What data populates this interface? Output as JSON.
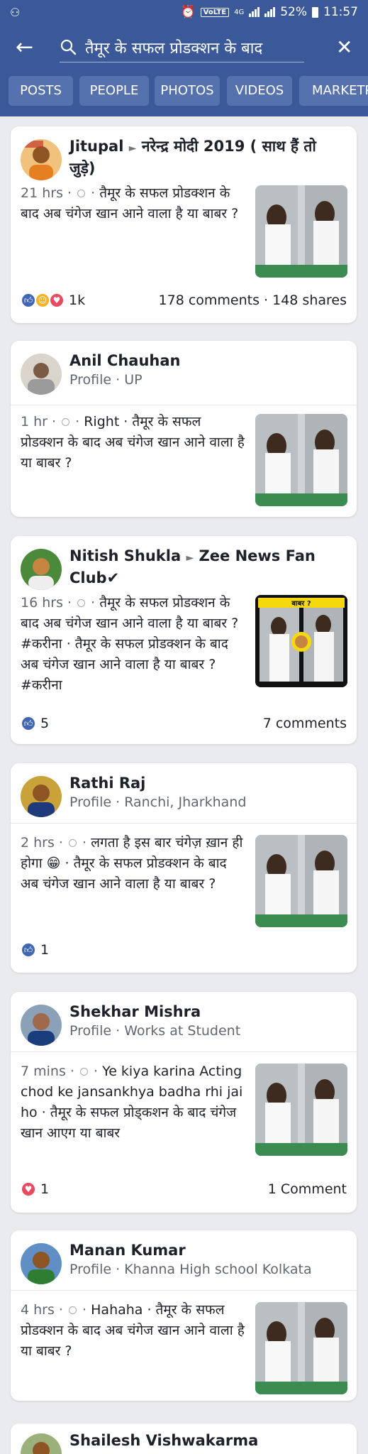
{
  "status_bar": {
    "left_icon": "incognito-icon",
    "volte": "VoLTE",
    "network": "4G",
    "battery": "52%",
    "time": "11:57"
  },
  "search": {
    "query": "तैमूर के सफल प्रोडक्शन के बाद"
  },
  "tabs": [
    "POSTS",
    "PEOPLE",
    "PHOTOS",
    "VIDEOS",
    "MARKETPLACE"
  ],
  "posts": [
    {
      "name": "Jitupal",
      "target": "नरेन्द्र मोदी 2019 ( साथ हैं तो जुड़े)",
      "subtitle": "",
      "time": "21 hrs",
      "text": "तैमूर के सफल प्रोडक्शन के बाद अब चंगेज खान आने वाला है या बाबर ?",
      "reactions": [
        "like",
        "haha",
        "love"
      ],
      "reaction_count": "1k",
      "comments": "178 comments",
      "shares": "148 shares",
      "thumb_caption": ""
    },
    {
      "name": "Anil Chauhan",
      "target": "",
      "subtitle": "Profile · UP",
      "time": "1 hr",
      "text": "Right · तैमूर के सफल प्रोडक्शन के बाद अब चंगेज खान आने वाला है या बाबर ?",
      "reactions": [],
      "reaction_count": "",
      "comments": "",
      "shares": "",
      "thumb_caption": ""
    },
    {
      "name": "Nitish Shukla",
      "target": "Zee News Fan Club✔",
      "subtitle": "",
      "time": "16 hrs",
      "text": "तैमूर के सफल प्रोडक्शन के बाद अब चंगेज खान आने वाला है या बाबर ? #करीना · तैमूर के सफल प्रोडक्शन के बाद अब चंगेज खान आने वाला है या बाबर ? #करीना",
      "reactions": [
        "like"
      ],
      "reaction_count": "5",
      "comments": "7 comments",
      "shares": "",
      "thumb_caption": "बाबर ?"
    },
    {
      "name": "Rathi Raj",
      "target": "",
      "subtitle": "Profile · Ranchi, Jharkhand",
      "time": "2 hrs",
      "text": "लगता है इस बार चंगेज़ ख़ान ही होगा 😁 · तैमूर के सफल प्रोडक्शन के बाद अब चंगेज खान आने वाला है या बाबर ?",
      "reactions": [
        "like"
      ],
      "reaction_count": "1",
      "comments": "",
      "shares": "",
      "thumb_caption": ""
    },
    {
      "name": "Shekhar Mishra",
      "target": "",
      "subtitle": "Profile · Works at Student",
      "time": "7 mins",
      "text": "Ye kiya karina Acting chod ke jansankhya badha rhi jai ho · तैमूर के सफल प्रोड्कशन  के बाद  चंगेज खान आएग या बाबर",
      "reactions": [
        "love"
      ],
      "reaction_count": "1",
      "comments": "1 Comment",
      "shares": "",
      "thumb_caption": ""
    },
    {
      "name": "Manan Kumar",
      "target": "",
      "subtitle": "Profile · Khanna High school Kolkata",
      "time": "4 hrs",
      "text": "Hahaha · तैमूर के सफल प्रोडक्शन के बाद अब चंगेज खान आने वाला है या बाबर ?",
      "reactions": [],
      "reaction_count": "",
      "comments": "",
      "shares": "",
      "thumb_caption": ""
    },
    {
      "name": "Shailesh Vishwakarma",
      "target": "",
      "subtitle": "",
      "time": "",
      "text": "",
      "reactions": [],
      "reaction_count": "",
      "comments": "",
      "shares": "",
      "thumb_caption": ""
    }
  ],
  "colors": {
    "brand": "#3b5998",
    "tab_bg": "#5672ae",
    "page_bg": "#e9ebee",
    "like": "#4267b2",
    "love": "#e84a5f",
    "haha": "#f7b125"
  }
}
